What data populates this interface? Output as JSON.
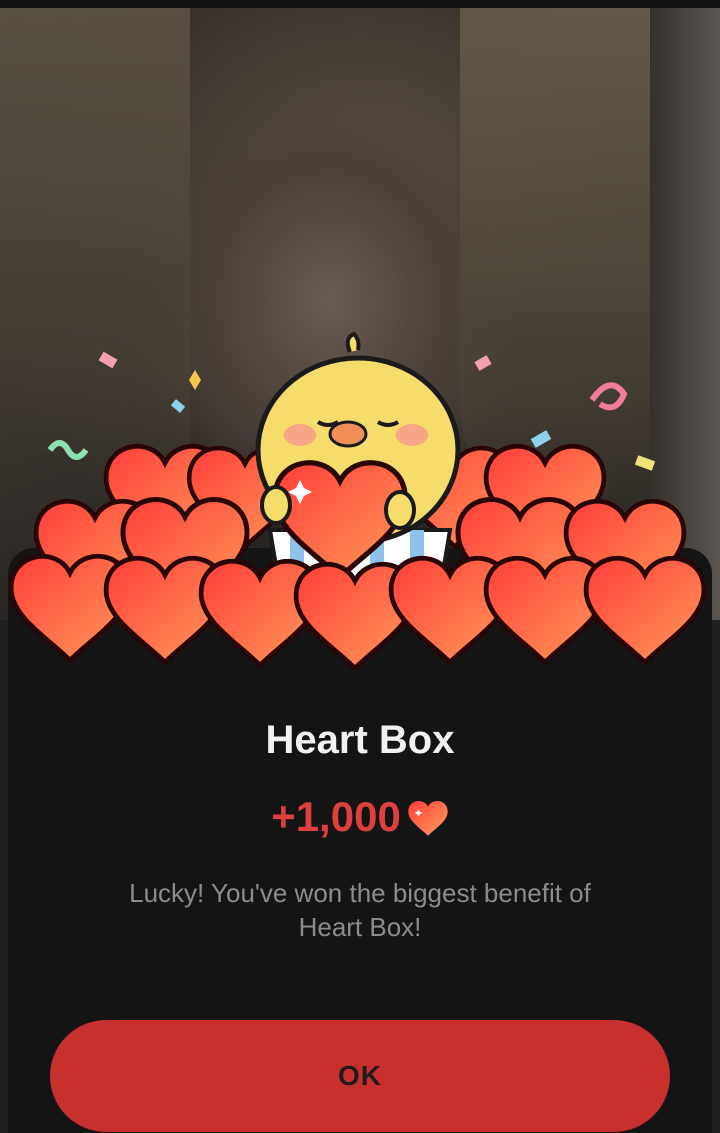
{
  "dialog": {
    "title": "Heart Box",
    "reward_amount": "+1,000",
    "reward_icon": "heart-icon",
    "message": "Lucky! You've won the biggest benefit of Heart Box!",
    "ok_label": "OK"
  },
  "colors": {
    "accent": "#c8302e",
    "reward_text": "#e0403d",
    "sheet_background": "#141414",
    "heart": "#ff5a4a"
  }
}
